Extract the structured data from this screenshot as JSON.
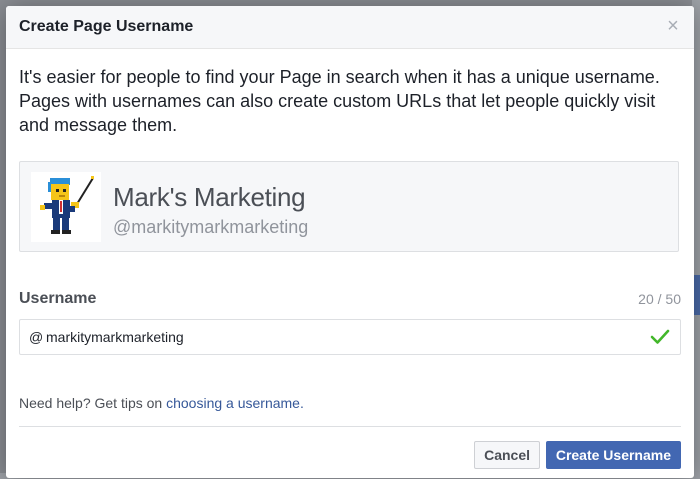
{
  "dialog": {
    "title": "Create Page Username",
    "close_symbol": "×"
  },
  "intro": {
    "text": "It's easier for people to find your Page in search when it has a unique username. Pages with usernames can also create custom URLs that let people quickly visit and message them."
  },
  "page_card": {
    "name": "Mark's Marketing",
    "handle": "@markitymarkmarketing",
    "avatar_icon": "pixel-character-conductor-icon"
  },
  "username": {
    "label": "Username",
    "counter": "20 / 50",
    "prefix": "@",
    "value": "markitymarkmarketing",
    "status_icon": "checkmark-icon",
    "status_color": "#42b72a"
  },
  "help": {
    "prefix_text": "Need help? Get tips on ",
    "link_text": "choosing a username."
  },
  "footer": {
    "cancel_label": "Cancel",
    "create_label": "Create Username"
  },
  "colors": {
    "accent": "#4267b2",
    "link": "#365899"
  }
}
